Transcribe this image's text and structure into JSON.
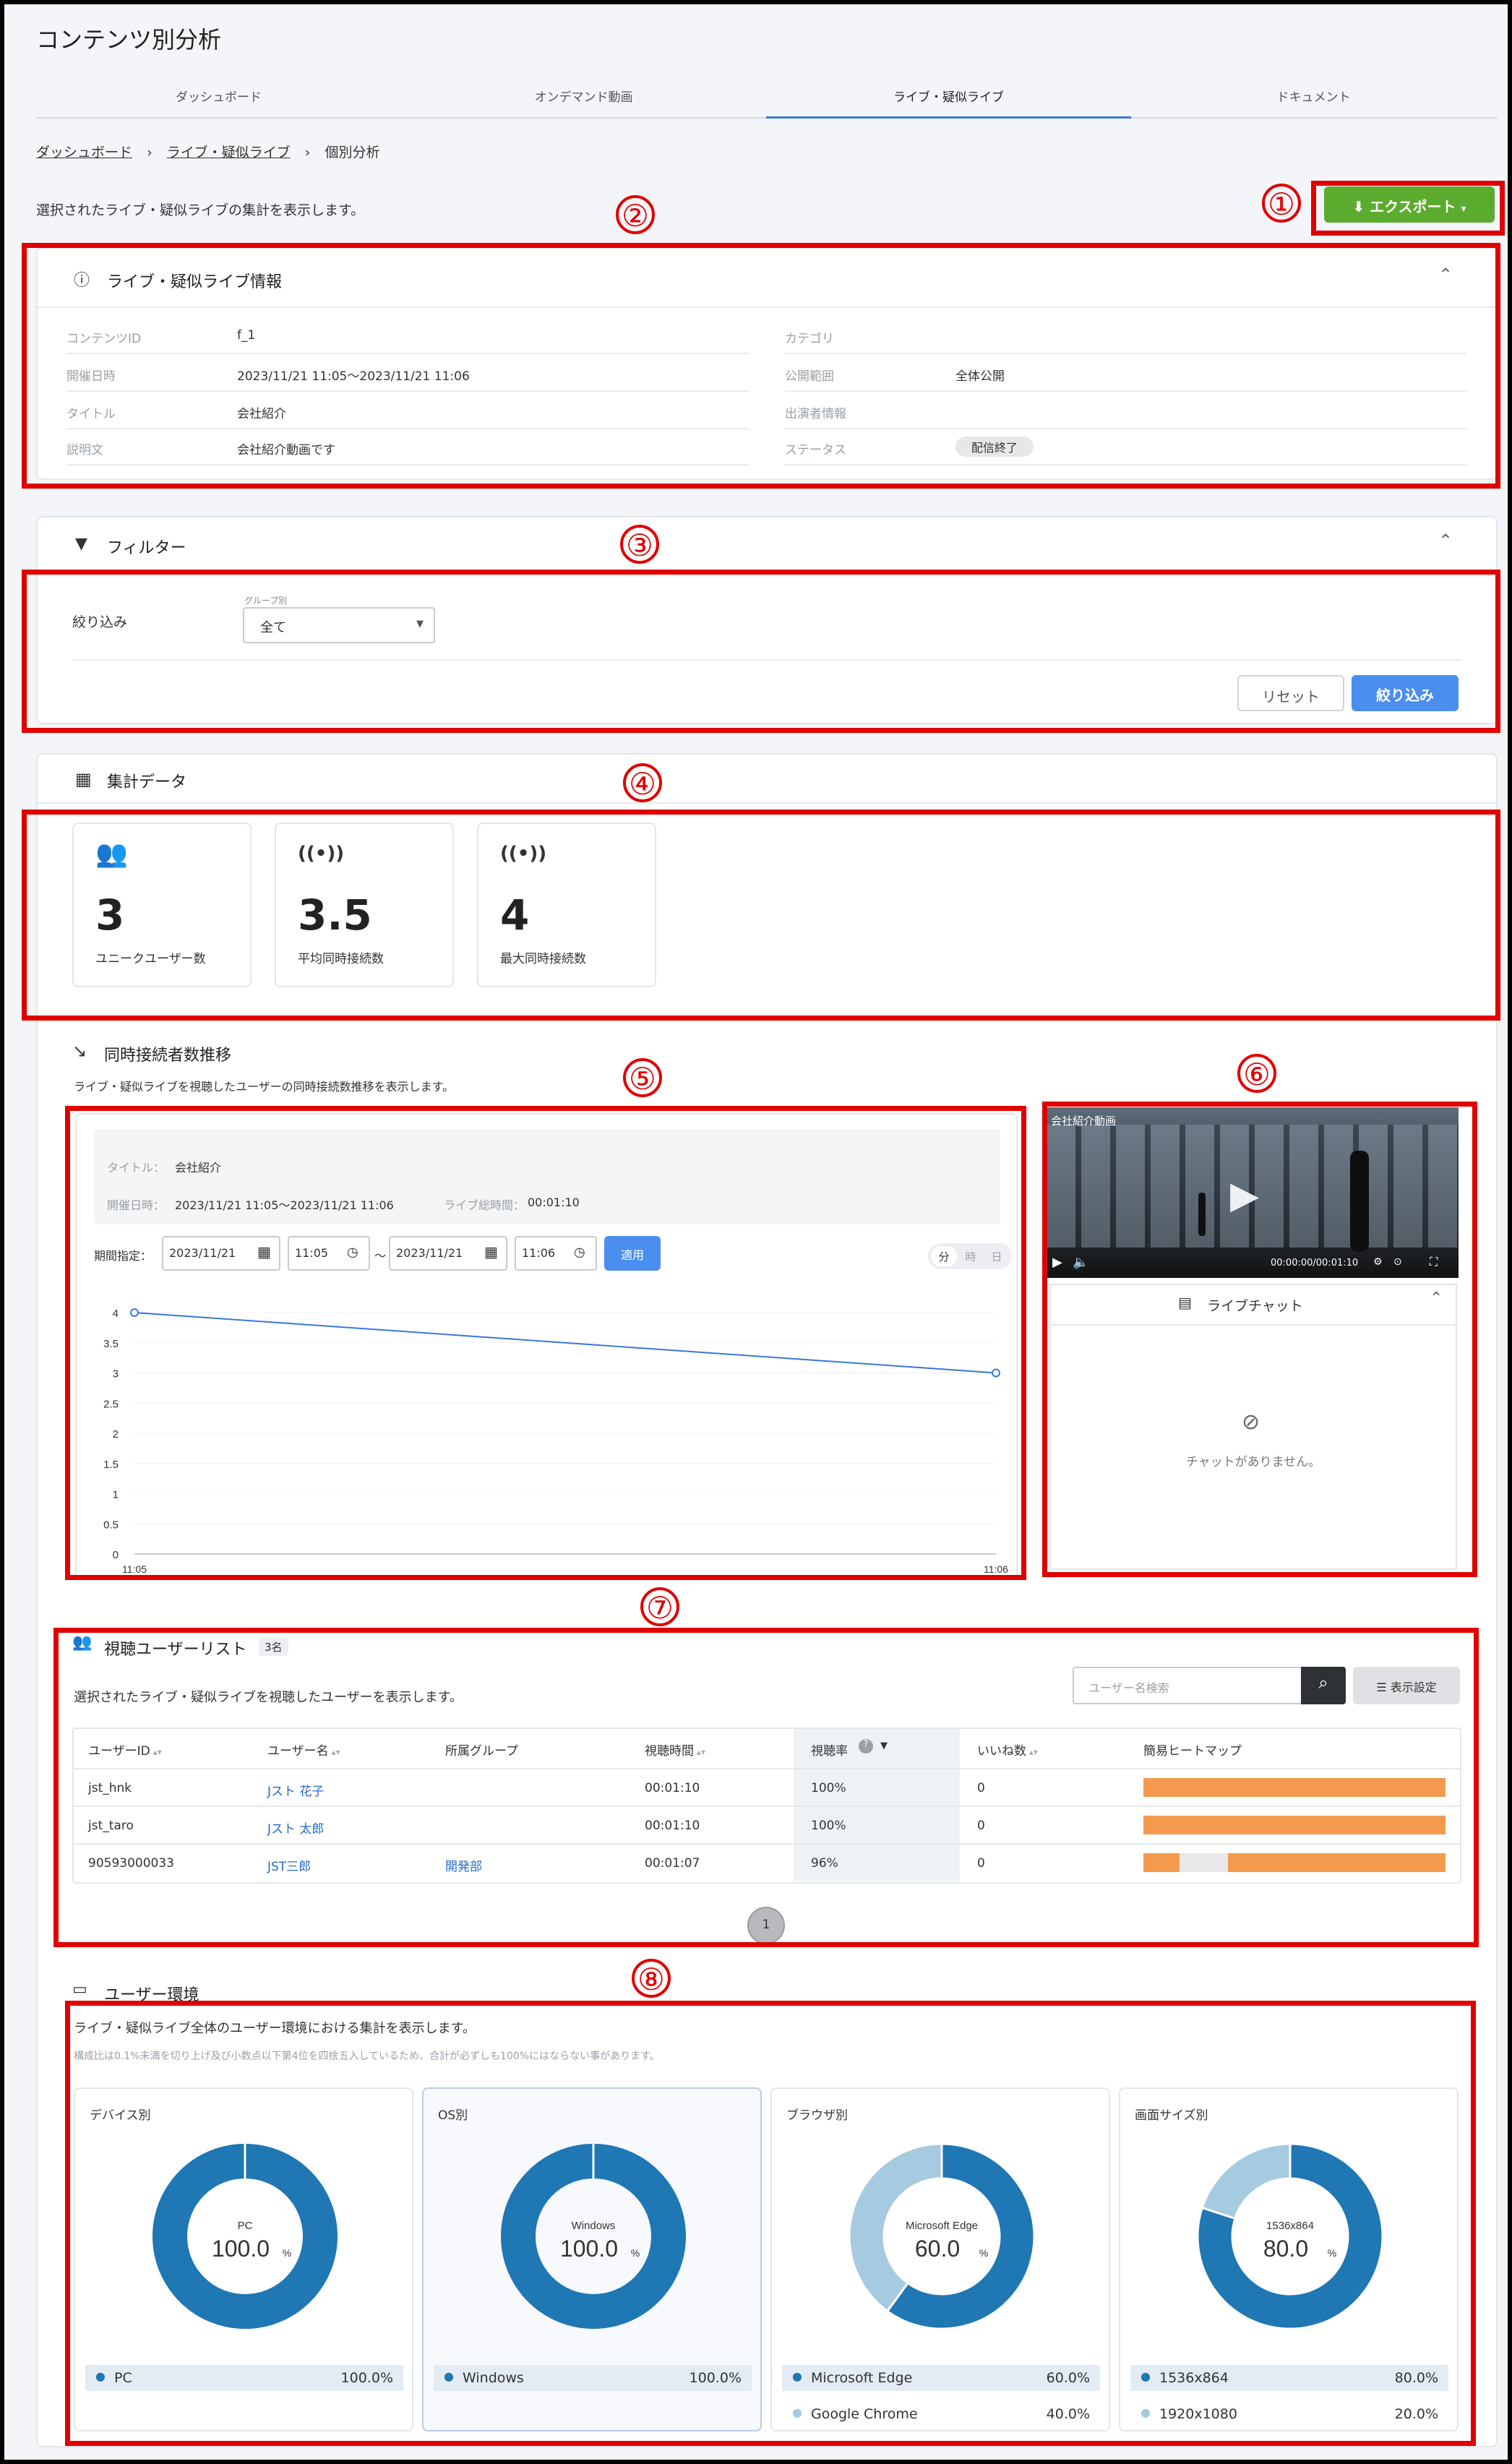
{
  "page": {
    "title": "コンテンツ別分析",
    "tabs": [
      "ダッシュボード",
      "オンデマンド動画",
      "ライブ・疑似ライブ",
      "ドキュメント"
    ],
    "active_tab": 2,
    "breadcrumb": [
      "ダッシュボード",
      "ライブ・疑似ライブ",
      "個別分析"
    ],
    "description": "選択されたライブ・疑似ライブの集計を表示します。",
    "export_label": "エクスポート"
  },
  "annotations": [
    "①",
    "②",
    "③",
    "④",
    "⑤",
    "⑥",
    "⑦",
    "⑧"
  ],
  "info": {
    "title": "ライブ・疑似ライブ情報",
    "left": [
      {
        "label": "コンテンツID",
        "value": "f_1"
      },
      {
        "label": "開催日時",
        "value": "2023/11/21 11:05〜2023/11/21 11:06"
      },
      {
        "label": "タイトル",
        "value": "会社紹介"
      },
      {
        "label": "説明文",
        "value": "会社紹介動画です"
      }
    ],
    "right": [
      {
        "label": "カテゴリ",
        "value": ""
      },
      {
        "label": "公開範囲",
        "value": "全体公開"
      },
      {
        "label": "出演者情報",
        "value": ""
      },
      {
        "label": "ステータス",
        "value": "配信終了"
      }
    ]
  },
  "filter": {
    "title": "フィルター",
    "narrow_label": "絞り込み",
    "group_label": "グループ別",
    "group_value": "全て",
    "reset_label": "リセット",
    "apply_label": "絞り込み"
  },
  "summary": {
    "title": "集計データ",
    "cards": [
      {
        "icon": "users-icon",
        "value": "3",
        "label": "ユニークユーザー数"
      },
      {
        "icon": "broadcast-icon",
        "value": "3.5",
        "label": "平均同時接続数"
      },
      {
        "icon": "broadcast-icon",
        "value": "4",
        "label": "最大同時接続数"
      }
    ]
  },
  "concurrent": {
    "title": "同時接続者数推移",
    "description": "ライブ・疑似ライブを視聴したユーザーの同時接続数推移を表示します。",
    "title_label": "タイトル：",
    "title_value": "会社紹介",
    "date_label": "開催日時：",
    "date_value": "2023/11/21 11:05〜2023/11/21 11:06",
    "duration_label": "ライブ総時間：",
    "duration_value": "00:01:10",
    "period_label": "期間指定：",
    "start_date": "2023/11/21",
    "start_time": "11:05",
    "tilde": "～",
    "end_date": "2023/11/21",
    "end_time": "11:06",
    "apply_label": "適用",
    "units": [
      "分",
      "時",
      "日"
    ]
  },
  "chart_data": {
    "type": "line",
    "x": [
      "11:05",
      "11:06"
    ],
    "series": [
      {
        "values": [
          4,
          3
        ]
      }
    ],
    "yticks": [
      "4",
      "3.5",
      "3",
      "2.5",
      "2",
      "1.5",
      "1",
      "0.5",
      "0"
    ],
    "ylim": [
      0,
      4
    ],
    "color": "#3a77d9"
  },
  "video": {
    "title": "会社紹介動画",
    "time": "00:00:00/00:01:10",
    "chat_title": "ライブチャット",
    "no_chat": "チャットがありません。"
  },
  "viewers": {
    "title": "視聴ユーザーリスト",
    "count": "3名",
    "description": "選択されたライブ・疑似ライブを視聴したユーザーを表示します。",
    "search_placeholder": "ユーザー名検索",
    "settings_label": "表示設定",
    "columns": [
      "ユーザーID",
      "ユーザー名",
      "所属グループ",
      "視聴時間",
      "視聴率",
      "いいね数",
      "簡易ヒートマップ"
    ],
    "rows": [
      {
        "id": "jst_hnk",
        "name": "Jスト 花子",
        "group": "",
        "time": "00:01:10",
        "rate": "100%",
        "likes": "0",
        "heat": 1.0
      },
      {
        "id": "jst_taro",
        "name": "Jスト 太郎",
        "group": "",
        "time": "00:01:10",
        "rate": "100%",
        "likes": "0",
        "heat": 1.0
      },
      {
        "id": "90593000033",
        "name": "JST三郎",
        "group": "開発部",
        "time": "00:01:07",
        "rate": "96%",
        "likes": "0",
        "heat": 0.96
      }
    ],
    "page": "1"
  },
  "environment": {
    "title": "ユーザー環境",
    "description": "ライブ・疑似ライブ全体のユーザー環境における集計を表示します。",
    "note": "構成比は0.1%未満を切り上げ及び小数点以下第4位を四捨五入しているため、合計が必ずしも100%にはならない事があります。",
    "colors": {
      "primary": "#1f77b4",
      "secondary": "#a6cbe0"
    },
    "panels": [
      {
        "title": "デバイス別",
        "center_label": "PC",
        "center_value": "100.0",
        "unit": "%",
        "items": [
          {
            "name": "PC",
            "pct": "100.0%",
            "value": 100
          }
        ]
      },
      {
        "title": "OS別",
        "center_label": "Windows",
        "center_value": "100.0",
        "unit": "%",
        "items": [
          {
            "name": "Windows",
            "pct": "100.0%",
            "value": 100
          }
        ]
      },
      {
        "title": "ブラウザ別",
        "center_label": "Microsoft Edge",
        "center_value": "60.0",
        "unit": "%",
        "items": [
          {
            "name": "Microsoft Edge",
            "pct": "60.0%",
            "value": 60
          },
          {
            "name": "Google Chrome",
            "pct": "40.0%",
            "value": 40
          }
        ]
      },
      {
        "title": "画面サイズ別",
        "center_label": "1536x864",
        "center_value": "80.0",
        "unit": "%",
        "items": [
          {
            "name": "1536x864",
            "pct": "80.0%",
            "value": 80
          },
          {
            "name": "1920x1080",
            "pct": "20.0%",
            "value": 20
          }
        ]
      }
    ]
  }
}
